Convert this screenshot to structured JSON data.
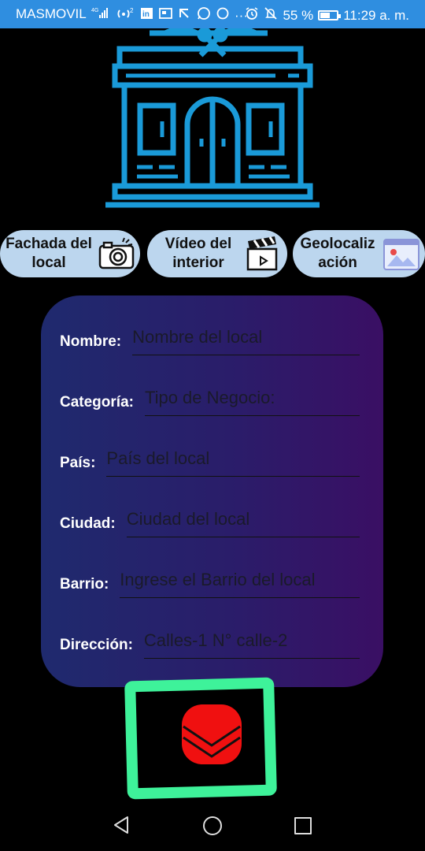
{
  "status_bar": {
    "carrier": "MASMOVIL",
    "network": "4G",
    "hotspot_count": "2",
    "dots": "···",
    "battery": "55 %",
    "battery_level": 0.55,
    "time": "11:29 a. m.",
    "icons": [
      "signal-icon",
      "hotspot-icon",
      "linkedin-icon",
      "news-icon",
      "route-icon",
      "whatsapp-icon",
      "circle-icon",
      "alarm-icon",
      "mute-icon",
      "battery-icon"
    ]
  },
  "media_buttons": [
    {
      "label": "Fachada del local",
      "icon": "camera-icon"
    },
    {
      "label": "Vídeo del interior",
      "icon": "clapperboard-icon"
    },
    {
      "label": "Geolocalización",
      "label_display": "Geolocaliz ación",
      "icon": "map-image-icon"
    }
  ],
  "form": {
    "fields": [
      {
        "label": "Nombre:",
        "placeholder": "Nombre del local",
        "value": ""
      },
      {
        "label": "Categoría:",
        "placeholder": "Tipo de Negocio:",
        "value": ""
      },
      {
        "label": "País:",
        "placeholder": "País del local",
        "value": ""
      },
      {
        "label": "Ciudad:",
        "placeholder": "Ciudad del local",
        "value": ""
      },
      {
        "label": "Barrio:",
        "placeholder": "Ingrese el Barrio del local",
        "value": ""
      },
      {
        "label": "Dirección:",
        "placeholder": "Calles-1 N° calle-2",
        "value": ""
      }
    ]
  },
  "submit": {
    "icon": "chevron-down-icon",
    "color": "#f01010",
    "highlight_color": "#3ef29a"
  },
  "colors": {
    "status_bar": "#2f8ee0",
    "logo": "#1a9ad8",
    "button_bg": "#bcd6ee",
    "card_start": "#1f2a6e",
    "card_end": "#3a0f64"
  },
  "nav": {
    "icons": [
      "back-icon",
      "home-icon",
      "recents-icon"
    ]
  }
}
